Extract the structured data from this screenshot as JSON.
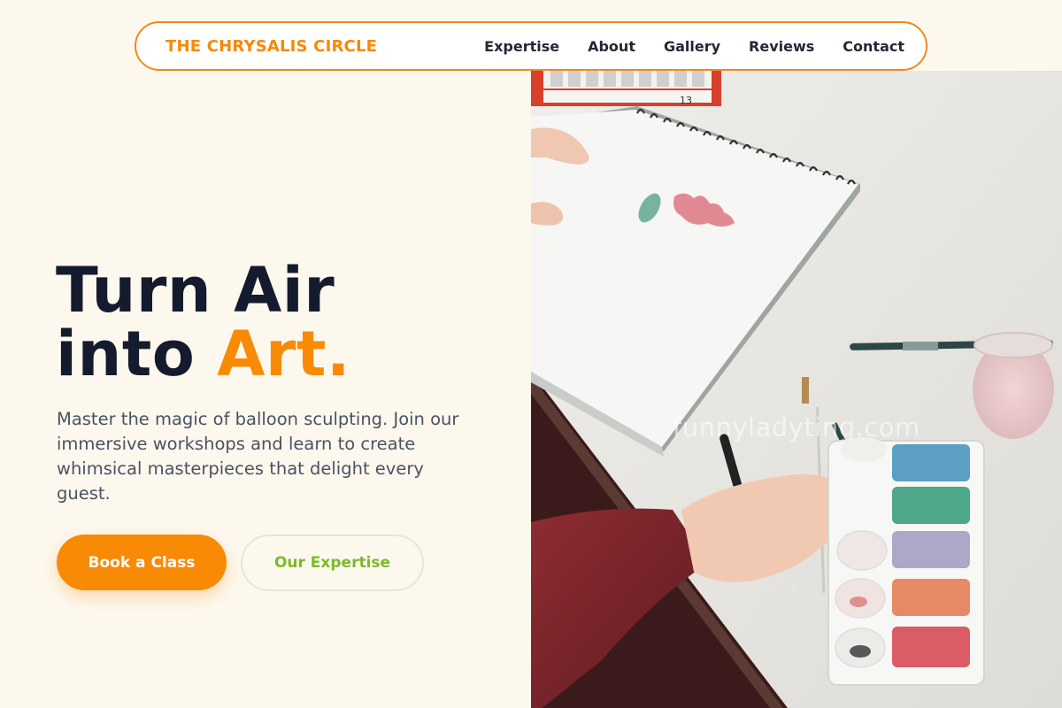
{
  "nav": {
    "brand": "THE CHRYSALIS CIRCLE",
    "links": [
      "Expertise",
      "About",
      "Gallery",
      "Reviews",
      "Contact"
    ]
  },
  "hero": {
    "title_line1": "Turn Air",
    "title_line2_plain": "into ",
    "title_line2_accent": "Art.",
    "description": "Master the magic of balloon sculpting. Join our immersive workshops and learn to create whimsical masterpieces that delight every guest.",
    "primary_button": "Book a Class",
    "secondary_button": "Our Expertise",
    "image_watermark": "funnyladyting.com",
    "paint_box_label": "13"
  },
  "colors": {
    "background": "#fdf8ee",
    "accent": "#f88a06",
    "secondary_text": "#7cba2a",
    "heading": "#151b2e"
  }
}
